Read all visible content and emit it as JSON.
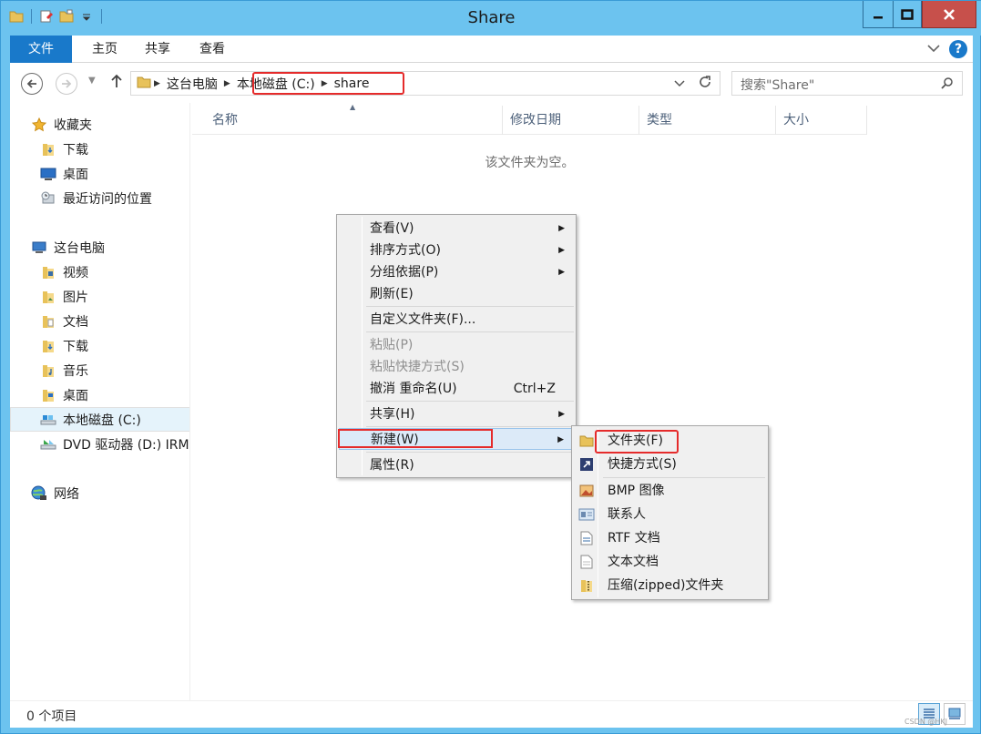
{
  "window": {
    "title": "Share"
  },
  "ribbon": {
    "tabs": [
      {
        "label": "文件"
      },
      {
        "label": "主页"
      },
      {
        "label": "共享"
      },
      {
        "label": "查看"
      }
    ],
    "help": "?"
  },
  "address": {
    "crumbs": [
      "这台电脑",
      "本地磁盘 (C:)",
      "share"
    ],
    "search_placeholder": "搜索\"Share\""
  },
  "sidebar": {
    "favorites": {
      "label": "收藏夹",
      "items": [
        {
          "label": "下载"
        },
        {
          "label": "桌面"
        },
        {
          "label": "最近访问的位置"
        }
      ]
    },
    "this_pc": {
      "label": "这台电脑",
      "items": [
        {
          "label": "视频"
        },
        {
          "label": "图片"
        },
        {
          "label": "文档"
        },
        {
          "label": "下载"
        },
        {
          "label": "音乐"
        },
        {
          "label": "桌面"
        },
        {
          "label": "本地磁盘 (C:)"
        },
        {
          "label": "DVD 驱动器 (D:) IRM"
        }
      ]
    },
    "network": {
      "label": "网络"
    }
  },
  "file_list": {
    "columns": [
      {
        "label": "名称"
      },
      {
        "label": "修改日期"
      },
      {
        "label": "类型"
      },
      {
        "label": "大小"
      }
    ],
    "empty_message": "该文件夹为空。"
  },
  "status": {
    "count": "0 个项目",
    "watermark": "CSDN @HKJ"
  },
  "context_menu": {
    "items": [
      {
        "label": "查看(V)"
      },
      {
        "label": "排序方式(O)"
      },
      {
        "label": "分组依据(P)"
      },
      {
        "label": "刷新(E)"
      },
      {
        "label": "自定义文件夹(F)..."
      },
      {
        "label": "粘贴(P)"
      },
      {
        "label": "粘贴快捷方式(S)"
      },
      {
        "label": "撤消 重命名(U)",
        "accelerator": "Ctrl+Z"
      },
      {
        "label": "共享(H)"
      },
      {
        "label": "新建(W)"
      },
      {
        "label": "属性(R)"
      }
    ]
  },
  "new_submenu": {
    "items": [
      {
        "label": "文件夹(F)",
        "icon": "folder-icon"
      },
      {
        "label": "快捷方式(S)",
        "icon": "shortcut-icon"
      },
      {
        "label": "BMP 图像",
        "icon": "bmp-image-icon"
      },
      {
        "label": "联系人",
        "icon": "contact-icon"
      },
      {
        "label": "RTF 文档",
        "icon": "rtf-document-icon"
      },
      {
        "label": "文本文档",
        "icon": "text-document-icon"
      },
      {
        "label": "压缩(zipped)文件夹",
        "icon": "zip-folder-icon"
      }
    ]
  },
  "colors": {
    "titlebar": "#6cc3ef",
    "file_tab": "#1979ca",
    "highlight_box": "#e52b2b",
    "menu_hot": "#dceaf8"
  }
}
